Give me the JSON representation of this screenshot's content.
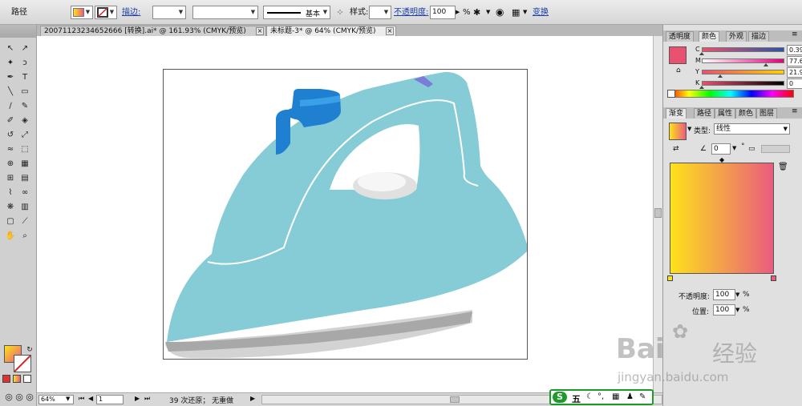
{
  "control_bar": {
    "object_type": "路径",
    "stroke_label": "描边:",
    "stroke_weight": "",
    "variable_width": "",
    "brush_label": "基本",
    "style_label": "样式:",
    "opacity_label": "不透明度:",
    "opacity_value": "100",
    "opacity_unit": "%",
    "transform_label": "变换",
    "fill_color": "#f6a070",
    "accent_link_color": "#1b3ea8"
  },
  "document_tabs": [
    {
      "label": "20071123234652666 [转换].ai* @ 161.93% (CMYK/预览)",
      "active": false
    },
    {
      "label": "未标题-3* @ 64% (CMYK/预览)",
      "active": true
    }
  ],
  "tools": {
    "icons": [
      "selection-tool",
      "direct-selection-tool",
      "magic-wand-tool",
      "lasso-tool",
      "pen-tool",
      "type-tool",
      "line-tool",
      "rectangle-tool",
      "paintbrush-tool",
      "pencil-tool",
      "blob-brush-tool",
      "eraser-tool",
      "rotate-tool",
      "scale-tool",
      "warp-tool",
      "free-transform-tool",
      "shape-builder-tool",
      "perspective-grid-tool",
      "mesh-tool",
      "gradient-tool",
      "eyedropper-tool",
      "blend-tool",
      "symbol-sprayer-tool",
      "column-graph-tool",
      "artboard-tool",
      "slice-tool",
      "hand-tool",
      "zoom-tool"
    ],
    "type_glyph": "T"
  },
  "status_bar": {
    "zoom": "64%",
    "page": "1",
    "history": "39 次还原； 无重做"
  },
  "ime": {
    "logo": "S",
    "mode": "五"
  },
  "color_panel": {
    "tabs": [
      "透明度",
      "颜色",
      "外观",
      "描边"
    ],
    "active_tab": "颜色",
    "swatch_color": "#e8516f",
    "rows": [
      {
        "channel": "C",
        "value": "0.39",
        "percent": 0.39
      },
      {
        "channel": "M",
        "value": "77.65",
        "percent": 77.65
      },
      {
        "channel": "Y",
        "value": "21.96",
        "percent": 21.96
      },
      {
        "channel": "K",
        "value": "0",
        "percent": 0
      }
    ],
    "unit": "%"
  },
  "gradient_panel": {
    "tabs": [
      "渐变",
      "路径",
      "属性",
      "颜色",
      "图层"
    ],
    "active_tab": "渐变",
    "type_label": "类型:",
    "type_value": "线性",
    "angle_value": "0",
    "angle_unit": "°",
    "start_color": "#fde21a",
    "end_color": "#ea5c7e",
    "opacity_label": "不透明度:",
    "opacity_value": "100",
    "location_label": "位置:",
    "location_value": "100",
    "unit": "%"
  },
  "watermark": {
    "brand": "Bai",
    "brand_suffix": "经验",
    "url": "jingyan.baidu.com"
  },
  "artwork": {
    "body_color": "#86ccd6",
    "button_color": "#1f7fd1",
    "base_color": "#a8a8a8"
  }
}
